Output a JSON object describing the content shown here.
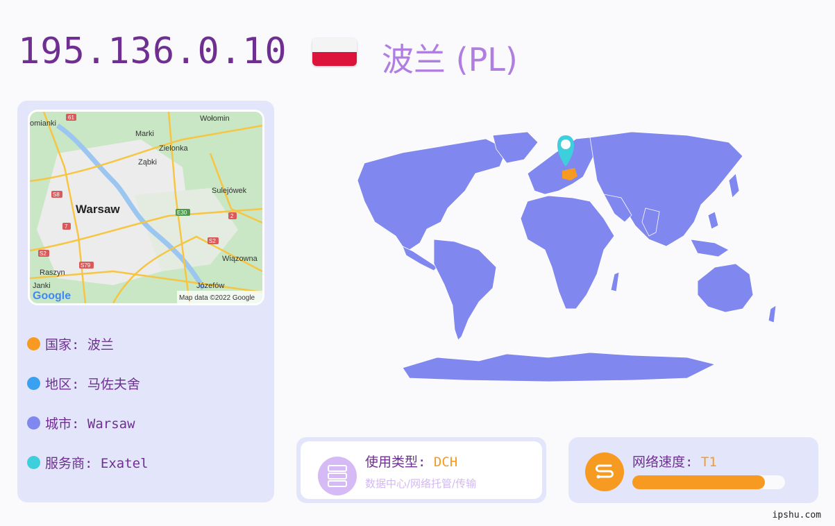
{
  "ip": "195.136.0.10",
  "country_title": "波兰 (PL)",
  "map": {
    "labels": [
      "omianki",
      "Wołomin",
      "Marki",
      "Zielonka",
      "Ząbki",
      "Sulejówek",
      "Warsaw",
      "Wiązowna",
      "Raszyn",
      "Janki",
      "Józefów"
    ],
    "road_badges": [
      "61",
      "S8",
      "7",
      "S2",
      "S79",
      "E30",
      "2",
      "S2"
    ],
    "google_logo": "Google",
    "attribution": "Map data ©2022 Google"
  },
  "info": [
    {
      "label": "国家: 波兰",
      "color": "#f79a22"
    },
    {
      "label": "地区: 马佐夫舍",
      "color": "#3aa0f0"
    },
    {
      "label": "城市: Warsaw",
      "color": "#8088f0"
    },
    {
      "label": "服务商: Exatel",
      "color": "#3ecfdc"
    }
  ],
  "usage": {
    "label": "使用类型: ",
    "value": "DCH",
    "description": "数据中心/网络托管/传输",
    "icon": "server-icon"
  },
  "speed": {
    "label": "网络速度: ",
    "value": "T1",
    "fill": 0.87,
    "icon": "speed-icon"
  },
  "colors": {
    "accent": "#6e2f91",
    "land": "#8088f0",
    "highlight": "#f79a22",
    "pin": "#3ecfdc"
  },
  "watermark": "ipshu.com"
}
